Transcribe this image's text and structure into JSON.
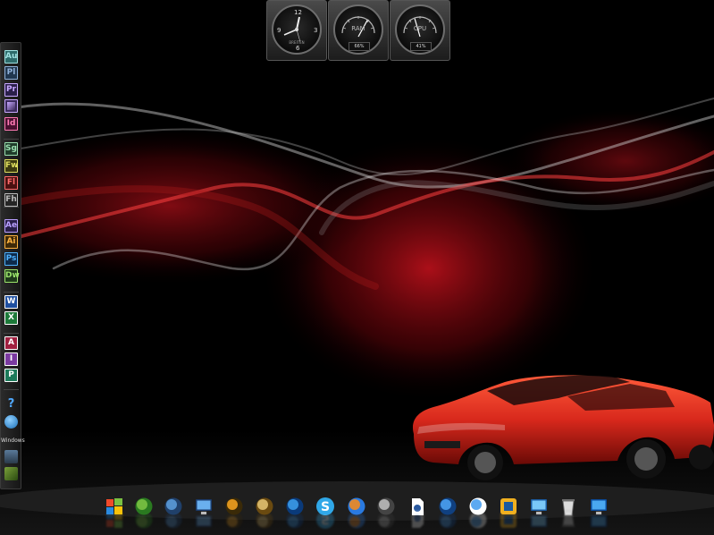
{
  "clock": {
    "numerals": [
      "12",
      "3",
      "6",
      "9"
    ],
    "brand": "BREITEN"
  },
  "ram_meter": {
    "label": "RAM",
    "value": "66%",
    "fraction": 0.66
  },
  "cpu_meter": {
    "label": "CPU",
    "value": "41%",
    "fraction": 0.41
  },
  "launcher": {
    "items": [
      {
        "label": "Au",
        "color": "#2d6b6b",
        "text_color": "#9fe0e0",
        "name": "audition"
      },
      {
        "label": "Pl",
        "color": "#21374f",
        "text_color": "#8fb0d8",
        "name": "prelude"
      },
      {
        "label": "Pr",
        "color": "#2a1f4a",
        "text_color": "#c8a8ff",
        "name": "premiere"
      },
      {
        "label": "",
        "color": "#3a2a5c",
        "text_color": "#c8a8ff",
        "name": "encore"
      },
      {
        "label": "Id",
        "color": "#4a1030",
        "text_color": "#ff7ab4",
        "name": "indesign"
      },
      {
        "label": "Sg",
        "color": "#1f3b2a",
        "text_color": "#9be0b0",
        "name": "speedgrade"
      },
      {
        "label": "Fw",
        "color": "#3b3a10",
        "text_color": "#e0e060",
        "name": "fireworks"
      },
      {
        "label": "Fl",
        "color": "#4a1010",
        "text_color": "#ff6b6b",
        "name": "flash"
      },
      {
        "label": "Fh",
        "color": "#252525",
        "text_color": "#bbbbbb",
        "name": "freehand"
      },
      {
        "label": "Ae",
        "color": "#2a1f4a",
        "text_color": "#b9a0ff",
        "name": "after-effects"
      },
      {
        "label": "Ai",
        "color": "#3e2a08",
        "text_color": "#ffb340",
        "name": "illustrator"
      },
      {
        "label": "Ps",
        "color": "#0d2a4a",
        "text_color": "#4fb3ff",
        "name": "photoshop"
      },
      {
        "label": "Dw",
        "color": "#1e3a1a",
        "text_color": "#9be36b",
        "name": "dreamweaver"
      },
      {
        "label": "W",
        "color": "#1e4fa0",
        "text_color": "#ffffff",
        "name": "word"
      },
      {
        "label": "X",
        "color": "#1d7a3a",
        "text_color": "#ffffff",
        "name": "excel"
      },
      {
        "label": "A",
        "color": "#a02040",
        "text_color": "#ffffff",
        "name": "access"
      },
      {
        "label": "I",
        "color": "#7a3aa0",
        "text_color": "#ffffff",
        "name": "infopath"
      },
      {
        "label": "P",
        "color": "#1d7a5a",
        "text_color": "#ffffff",
        "name": "publisher"
      }
    ],
    "help_symbol": "?",
    "windows_label": "Windows"
  },
  "taskbar": {
    "icons": [
      "windows-logo-icon",
      "media-center-icon",
      "network-icon",
      "computer-icon",
      "media-player-icon",
      "tools-icon",
      "internet-explorer-icon",
      "skype-icon",
      "messenger-icon",
      "rocket-icon",
      "document-icon",
      "globe-icon",
      "network-globe-icon",
      "vmware-icon",
      "control-panel-icon",
      "recycle-bin-icon",
      "show-desktop-icon"
    ]
  },
  "colors": {
    "background": "#000000",
    "accent_red": "#c0101a",
    "car_red": "#d8281c"
  }
}
